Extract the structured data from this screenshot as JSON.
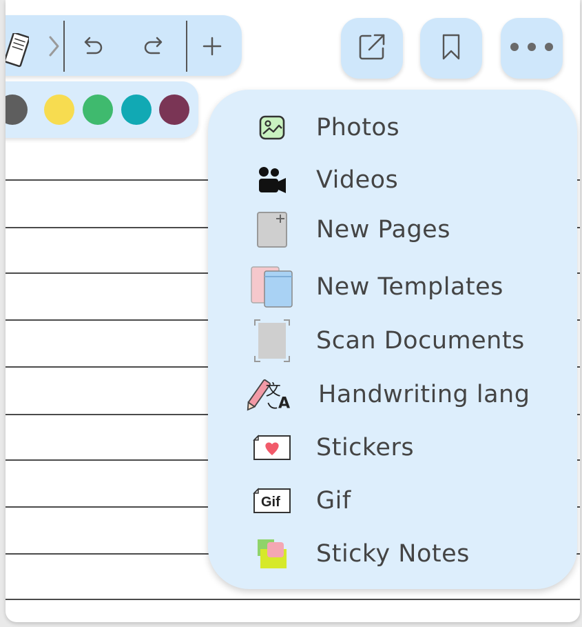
{
  "toolbar": {
    "icons": [
      "notebook-icon",
      "chevron-right-icon",
      "undo-icon",
      "redo-icon",
      "plus-icon"
    ]
  },
  "palette": {
    "colors": [
      "#5e5e5e",
      "#f7dc50",
      "#3fba6e",
      "#11a9b4",
      "#7a3555"
    ]
  },
  "top_right_buttons": [
    "share-icon",
    "bookmark-icon",
    "more-icon"
  ],
  "menu": {
    "items": [
      {
        "label": "Photos",
        "icon": "photo-icon"
      },
      {
        "label": "Videos",
        "icon": "video-camera-icon"
      },
      {
        "label": "New Pages",
        "icon": "new-page-icon"
      },
      {
        "label": "New Templates",
        "icon": "templates-icon"
      },
      {
        "label": "Scan Documents",
        "icon": "scan-icon"
      },
      {
        "label": "Handwriting lang",
        "icon": "handwriting-language-icon"
      },
      {
        "label": "Stickers",
        "icon": "sticker-icon"
      },
      {
        "label": "Gif",
        "icon": "gif-icon"
      },
      {
        "label": "Sticky Notes",
        "icon": "sticky-notes-icon"
      }
    ]
  },
  "colors": {
    "toolbar_bg": "#cfe7fb",
    "menu_bg": "#ddeefc",
    "text": "#444444"
  }
}
